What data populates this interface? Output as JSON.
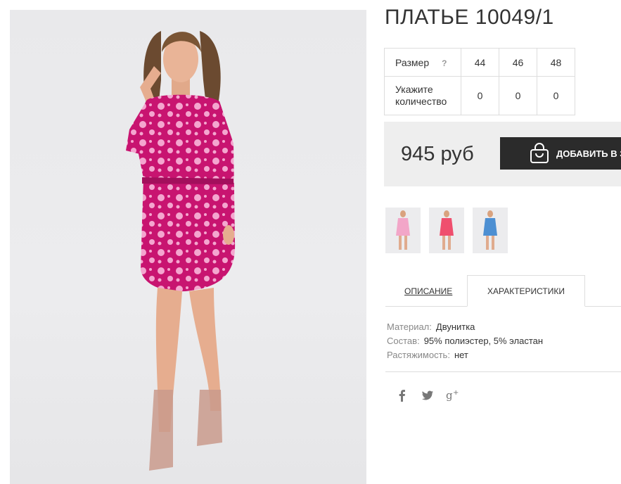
{
  "product": {
    "title": "ПЛАТЬЕ 10049/1",
    "size_label": "Размер",
    "size_help": "?",
    "sizes": [
      "44",
      "46",
      "48"
    ],
    "qty_label_line1": "Укажите",
    "qty_label_line2": "количество",
    "quantities": [
      "0",
      "0",
      "0"
    ],
    "price": "945 руб",
    "add_to_cart_label": "ДОБАВИТЬ В ЗАКАЗ"
  },
  "thumbnails": [
    {
      "color": "#f2a6c8",
      "icon": "pink-dress-thumbnail"
    },
    {
      "color": "#ef4f6e",
      "icon": "coral-dress-thumbnail"
    },
    {
      "color": "#4d8fd2",
      "icon": "blue-dress-thumbnail"
    }
  ],
  "tabs": {
    "description": "ОПИСАНИЕ",
    "characteristics": "ХАРАКТЕРИСТИКИ"
  },
  "specs": [
    {
      "key": "Материал:",
      "value": "Двунитка"
    },
    {
      "key": "Состав:",
      "value": "95% полиэстер, 5% эластан"
    },
    {
      "key": "Растяжимость:",
      "value": "нет"
    }
  ],
  "social": {
    "facebook": "f",
    "twitter": "twitter-icon",
    "googleplus": "g+"
  },
  "colors": {
    "dress": "#c81470",
    "dress_flowers": "#f4a6cf",
    "button": "#2b2b2b",
    "price_bg": "#eeeeee"
  }
}
